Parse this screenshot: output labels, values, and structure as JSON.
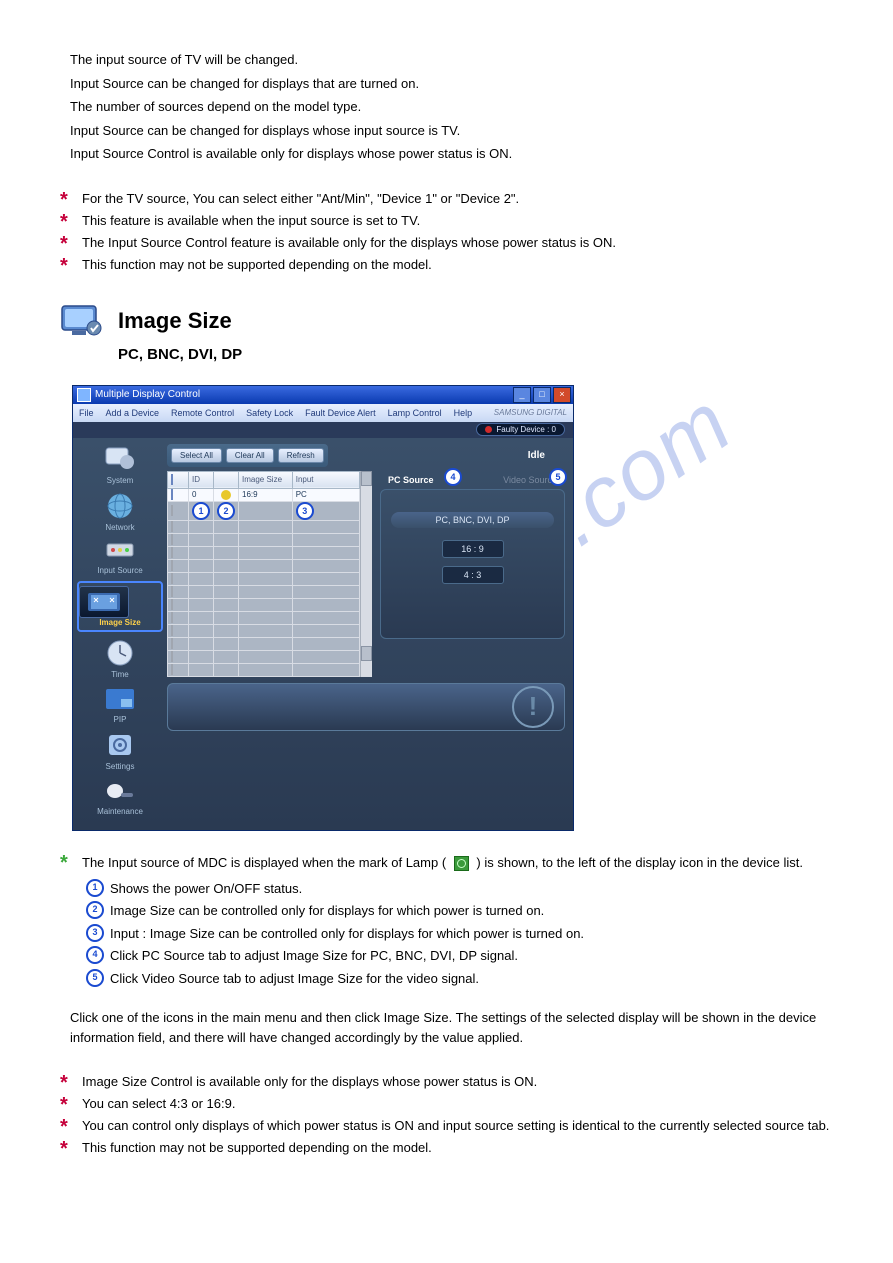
{
  "intro": {
    "p1": "The input source of TV will be changed.",
    "p2": "Input Source can be changed for displays that are turned on.",
    "p3": "The number of sources depend on the model type.",
    "p4": "Input Source can be changed for displays whose input source is TV.",
    "p5": "Input Source Control is available only for displays whose power status is ON."
  },
  "notes_top": [
    "For the TV source, You can select either \"Ant/Min\", \"Device 1\" or \"Device 2\".",
    "This feature is available when the input source is set to TV.",
    "The Input Source Control feature is available only for the displays whose power status is ON.",
    "This function may not be supported depending on the model."
  ],
  "heading": "Image Size",
  "subheading": "PC, BNC, DVI, DP",
  "app": {
    "window_title": "Multiple Display Control",
    "menus": [
      "File",
      "Add a Device",
      "Remote Control",
      "Safety Lock",
      "Fault Device Alert",
      "Lamp Control",
      "Help"
    ],
    "brand": "SAMSUNG DIGITAL",
    "faulty": "Faulty Device : 0",
    "top_buttons": [
      "Select All",
      "Clear All",
      "Refresh"
    ],
    "idle": "Idle",
    "table": {
      "headers": [
        "",
        "ID",
        "",
        "Image Size",
        "Input"
      ],
      "row1": {
        "id": "0",
        "image_size": "16:9",
        "input": "PC"
      },
      "col_badges": [
        "1",
        "2",
        "3"
      ]
    },
    "sidebar": [
      "System",
      "Network",
      "Input Source",
      "Image Size",
      "Time",
      "PIP",
      "Settings",
      "Maintenance"
    ],
    "tabs": {
      "active": "PC Source",
      "inactive": "Video Source",
      "badge_active": "4",
      "badge_inactive": "5"
    },
    "panel": {
      "label": "PC, BNC, DVI, DP",
      "btn1": "16 : 9",
      "btn2": "4 : 3"
    }
  },
  "lamp_note": {
    "prefix": "The Input source of MDC is displayed when the mark of Lamp (  ",
    "suffix": "  ) is shown, to the left of the display icon in the device list."
  },
  "numbered": [
    "Shows the power On/OFF status.",
    "Image Size can be controlled only for displays for which power is turned on.",
    "Input : Image Size can be controlled only for displays for which power is turned on.",
    "Click PC Source tab to adjust Image Size for PC, BNC, DVI, DP signal.",
    "Click Video Source tab to adjust Image Size for the video signal."
  ],
  "body_mid": "Click one of the icons in the main menu and then click Image Size. The settings of the selected display will be shown in the device information field, and there will have changed accordingly by the value applied.",
  "notes_bottom": [
    "Image Size Control is available only for the displays whose power status is ON.",
    "You can select 4:3 or 16:9.",
    "You can control only displays of which power status is ON and input source setting is identical to the currently selected source tab.",
    "This function may not be supported depending on the model."
  ]
}
